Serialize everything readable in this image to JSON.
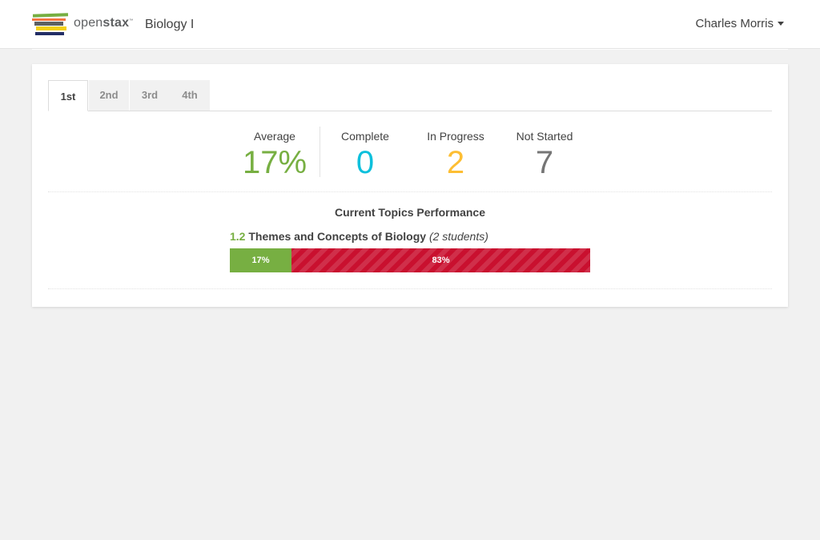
{
  "navbar": {
    "brand": {
      "prefix": "open",
      "bold": "stax",
      "tm": "™"
    },
    "course_title": "Biology I",
    "user_name": "Charles Morris"
  },
  "tabs": [
    {
      "label": "1st",
      "active": true
    },
    {
      "label": "2nd",
      "active": false
    },
    {
      "label": "3rd",
      "active": false
    },
    {
      "label": "4th",
      "active": false
    }
  ],
  "stats": {
    "average": {
      "label": "Average",
      "value": "17%",
      "color": "#77af42"
    },
    "complete": {
      "label": "Complete",
      "value": "0",
      "color": "#0dc0dc"
    },
    "in_progress": {
      "label": "In Progress",
      "value": "2",
      "color": "#fdbe33"
    },
    "not_started": {
      "label": "Not Started",
      "value": "7",
      "color": "#757575"
    }
  },
  "performance": {
    "title": "Current Topics Performance",
    "topics": [
      {
        "number": "1.2",
        "name": "Themes and Concepts of Biology",
        "count": "(2 students)",
        "correct": {
          "label": "17%",
          "fraction": 0.17,
          "color": "#77af42"
        },
        "incorrect": {
          "label": "83%",
          "fraction": 0.83,
          "color": "#c9102f"
        }
      }
    ]
  },
  "icons": {
    "logo": "openstax-books-logo",
    "caret": "caret-down-icon"
  }
}
